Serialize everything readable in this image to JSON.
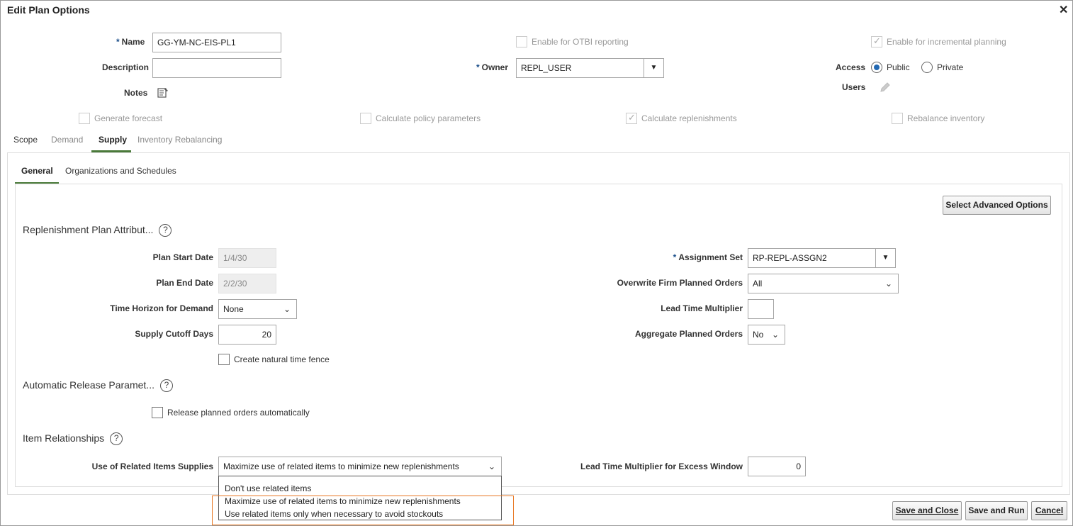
{
  "dialog": {
    "title": "Edit Plan Options",
    "close_icon": "✕"
  },
  "header": {
    "name_label": "Name",
    "name_value": "GG-YM-NC-EIS-PL1",
    "description_label": "Description",
    "description_value": "",
    "notes_label": "Notes",
    "otbi_label": "Enable for OTBI reporting",
    "owner_label": "Owner",
    "owner_value": "REPL_USER",
    "incremental_label": "Enable for incremental planning",
    "access_label": "Access",
    "access_public": "Public",
    "access_private": "Private",
    "access_selected": "Public",
    "users_label": "Users"
  },
  "options": {
    "generate_forecast": "Generate forecast",
    "calc_policy": "Calculate policy parameters",
    "calc_replenishments": "Calculate replenishments",
    "rebalance": "Rebalance inventory"
  },
  "tabs": [
    {
      "label": "Scope"
    },
    {
      "label": "Demand"
    },
    {
      "label": "Supply"
    },
    {
      "label": "Inventory Rebalancing"
    }
  ],
  "subtabs": [
    {
      "label": "General"
    },
    {
      "label": "Organizations and Schedules"
    }
  ],
  "general": {
    "advanced_button": "Select Advanced Options",
    "section_attributes": "Replenishment Plan Attribut...",
    "plan_start_label": "Plan Start Date",
    "plan_start_value": "1/4/30",
    "plan_end_label": "Plan End Date",
    "plan_end_value": "2/2/30",
    "time_horizon_label": "Time Horizon for Demand",
    "time_horizon_value": "None",
    "cutoff_label": "Supply Cutoff Days",
    "cutoff_value": "20",
    "fence_label": "Create natural time fence",
    "assignment_label": "Assignment Set",
    "assignment_value": "RP-REPL-ASSGN2",
    "overwrite_label": "Overwrite Firm Planned Orders",
    "overwrite_value": "All",
    "lead_mult_label": "Lead Time Multiplier",
    "lead_mult_value": "",
    "aggregate_label": "Aggregate Planned Orders",
    "aggregate_value": "No",
    "section_release": "Automatic Release Paramet...",
    "release_label": "Release planned orders automatically",
    "section_items": "Item Relationships",
    "related_label": "Use of Related Items Supplies",
    "related_value": "Maximize use of related items to minimize new replenishments",
    "excess_label": "Lead Time Multiplier for Excess Window",
    "excess_value": "0"
  },
  "related_options": [
    "Don't use related items",
    "Maximize use of related items to minimize new replenishments",
    "Use related items only when necessary to avoid stockouts"
  ],
  "footer": {
    "save_close": "Save and Close",
    "save_run": "Save and Run",
    "cancel": "Cancel"
  },
  "colors": {
    "tab_underline": "#4a7a3a",
    "radio_selected": "#2369b3",
    "highlight_border": "#e87722"
  }
}
